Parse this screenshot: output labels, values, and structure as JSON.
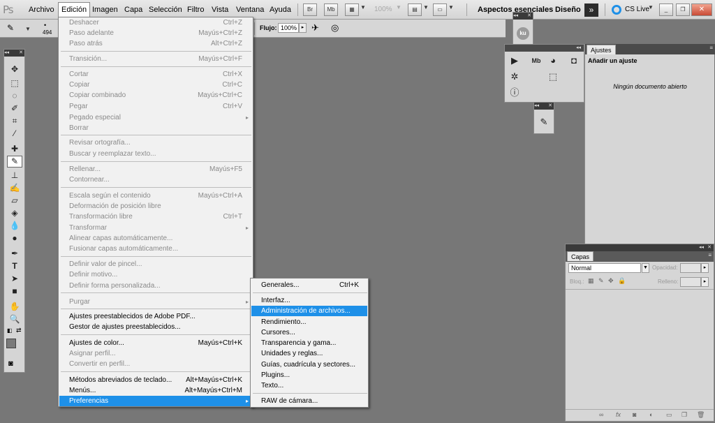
{
  "app": {
    "logo": "Ps"
  },
  "menubar": {
    "items": [
      "Archivo",
      "Edición",
      "Imagen",
      "Capa",
      "Selección",
      "Filtro",
      "Vista",
      "Ventana",
      "Ayuda"
    ],
    "open": "Edición"
  },
  "appbar": {
    "br_label": "Br",
    "mb_label": "Mb",
    "zoom": "100%",
    "workspace_active": "Aspectos esenciales",
    "workspace_other": "Diseño",
    "cs_live": "CS Live"
  },
  "options": {
    "brush_size": "494",
    "flujo_label": "Flujo:",
    "flujo_value": "100%"
  },
  "edit_menu": [
    {
      "label": "Deshacer",
      "shortcut": "Ctrl+Z",
      "disabled": true
    },
    {
      "label": "Paso adelante",
      "shortcut": "Mayús+Ctrl+Z",
      "disabled": true
    },
    {
      "label": "Paso atrás",
      "shortcut": "Alt+Ctrl+Z",
      "disabled": true
    },
    {
      "label": "Transición...",
      "shortcut": "Mayús+Ctrl+F",
      "disabled": true
    },
    {
      "label": "Cortar",
      "shortcut": "Ctrl+X",
      "disabled": true
    },
    {
      "label": "Copiar",
      "shortcut": "Ctrl+C",
      "disabled": true
    },
    {
      "label": "Copiar combinado",
      "shortcut": "Mayús+Ctrl+C",
      "disabled": true
    },
    {
      "label": "Pegar",
      "shortcut": "Ctrl+V",
      "disabled": true
    },
    {
      "label": "Pegado especial",
      "shortcut": "",
      "disabled": true
    },
    {
      "label": "Borrar",
      "shortcut": "",
      "disabled": true
    },
    {
      "label": "Revisar ortografía...",
      "shortcut": "",
      "disabled": true
    },
    {
      "label": "Buscar y reemplazar texto...",
      "shortcut": "",
      "disabled": true
    },
    {
      "label": "Rellenar...",
      "shortcut": "Mayús+F5",
      "disabled": true
    },
    {
      "label": "Contornear...",
      "shortcut": "",
      "disabled": true
    },
    {
      "label": "Escala según el contenido",
      "shortcut": "Mayús+Ctrl+A",
      "disabled": true
    },
    {
      "label": "Deformación de posición libre",
      "shortcut": "",
      "disabled": true
    },
    {
      "label": "Transformación libre",
      "shortcut": "Ctrl+T",
      "disabled": true
    },
    {
      "label": "Transformar",
      "shortcut": "",
      "disabled": true
    },
    {
      "label": "Alinear capas automáticamente...",
      "shortcut": "",
      "disabled": true
    },
    {
      "label": "Fusionar capas automáticamente...",
      "shortcut": "",
      "disabled": true
    },
    {
      "label": "Definir valor de pincel...",
      "shortcut": "",
      "disabled": true
    },
    {
      "label": "Definir motivo...",
      "shortcut": "",
      "disabled": true
    },
    {
      "label": "Definir forma personalizada...",
      "shortcut": "",
      "disabled": true
    },
    {
      "label": "Purgar",
      "shortcut": "",
      "disabled": true
    },
    {
      "label": "Ajustes preestablecidos de Adobe PDF...",
      "shortcut": "",
      "disabled": false
    },
    {
      "label": "Gestor de ajustes preestablecidos...",
      "shortcut": "",
      "disabled": false
    },
    {
      "label": "Ajustes de color...",
      "shortcut": "Mayús+Ctrl+K",
      "disabled": false
    },
    {
      "label": "Asignar perfil...",
      "shortcut": "",
      "disabled": true
    },
    {
      "label": "Convertir en perfil...",
      "shortcut": "",
      "disabled": true
    },
    {
      "label": "Métodos abreviados de teclado...",
      "shortcut": "Alt+Mayús+Ctrl+K",
      "disabled": false
    },
    {
      "label": "Menús...",
      "shortcut": "Alt+Mayús+Ctrl+M",
      "disabled": false
    },
    {
      "label": "Preferencias",
      "shortcut": "",
      "disabled": false
    }
  ],
  "prefs_submenu": [
    {
      "label": "Generales...",
      "shortcut": "Ctrl+K"
    },
    {
      "label": "Interfaz...",
      "shortcut": ""
    },
    {
      "label": "Administración de archivos...",
      "shortcut": ""
    },
    {
      "label": "Rendimiento...",
      "shortcut": ""
    },
    {
      "label": "Cursores...",
      "shortcut": ""
    },
    {
      "label": "Transparencia y gama...",
      "shortcut": ""
    },
    {
      "label": "Unidades y reglas...",
      "shortcut": ""
    },
    {
      "label": "Guías, cuadrícula y sectores...",
      "shortcut": ""
    },
    {
      "label": "Plugins...",
      "shortcut": ""
    },
    {
      "label": "Texto...",
      "shortcut": ""
    },
    {
      "label": "RAW de cámara...",
      "shortcut": ""
    }
  ],
  "ajustes_panel": {
    "tab": "Ajustes",
    "title": "Añadir un ajuste",
    "message": "Ningún documento abierto"
  },
  "capas_panel": {
    "tab": "Capas",
    "blend_mode": "Normal",
    "opacity_label": "Opacidad:",
    "lock_label": "Bloq.:",
    "fill_label": "Relleno:"
  },
  "mini_panel": {
    "ku_label": "ku",
    "mb_label": "Mb"
  },
  "colors": {
    "highlight": "#1e90e8",
    "workspace_bg": "#777777"
  }
}
